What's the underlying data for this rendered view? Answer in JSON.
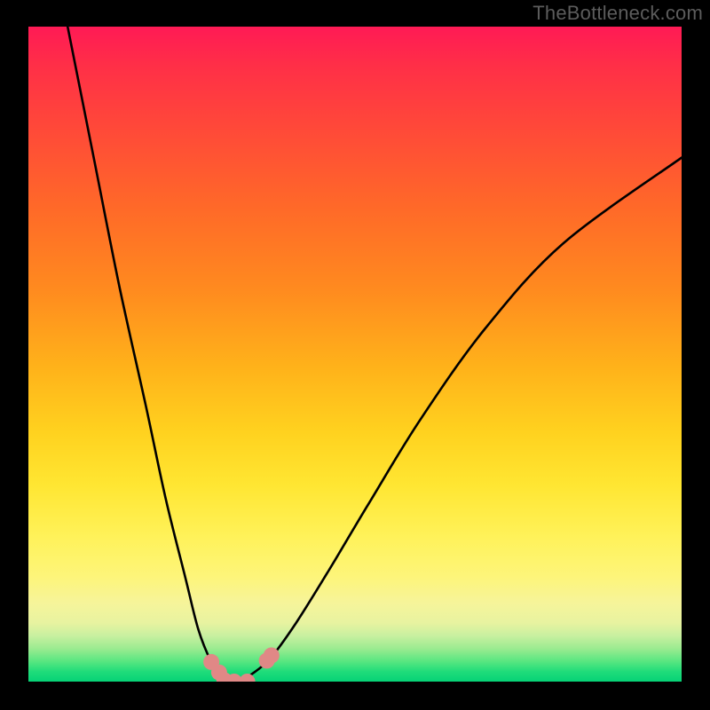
{
  "watermark": "TheBottleneck.com",
  "chart_data": {
    "type": "line",
    "title": "",
    "xlabel": "",
    "ylabel": "",
    "xlim": [
      0,
      100
    ],
    "ylim": [
      0,
      100
    ],
    "grid": false,
    "series": [
      {
        "name": "bottleneck-curve",
        "x": [
          6,
          10,
          14,
          18,
          21,
          24,
          26,
          28,
          29.5,
          31,
          32.5,
          34,
          37,
          41,
          46,
          52,
          60,
          70,
          82,
          100
        ],
        "values": [
          100,
          80,
          60,
          42,
          28,
          16,
          8,
          3,
          1,
          0,
          0,
          1,
          3.5,
          9,
          17,
          27,
          40,
          54,
          67,
          80
        ]
      }
    ],
    "markers": [
      {
        "name": "marker-a",
        "x": 28.0,
        "y": 3.0
      },
      {
        "name": "marker-b",
        "x": 29.2,
        "y": 1.4
      },
      {
        "name": "marker-c",
        "x": 30.0,
        "y": 0.2
      },
      {
        "name": "marker-d",
        "x": 31.5,
        "y": 0.0
      },
      {
        "name": "marker-e",
        "x": 33.5,
        "y": 0.0
      },
      {
        "name": "marker-f",
        "x": 36.5,
        "y": 3.2
      },
      {
        "name": "marker-g",
        "x": 37.2,
        "y": 4.0
      }
    ],
    "background_gradient": {
      "stops": [
        {
          "pos": 0.0,
          "color": "#ff1a55"
        },
        {
          "pos": 0.28,
          "color": "#ff6a28"
        },
        {
          "pos": 0.62,
          "color": "#ffd21f"
        },
        {
          "pos": 0.84,
          "color": "#fdf57a"
        },
        {
          "pos": 1.0,
          "color": "#06d276"
        }
      ]
    }
  }
}
